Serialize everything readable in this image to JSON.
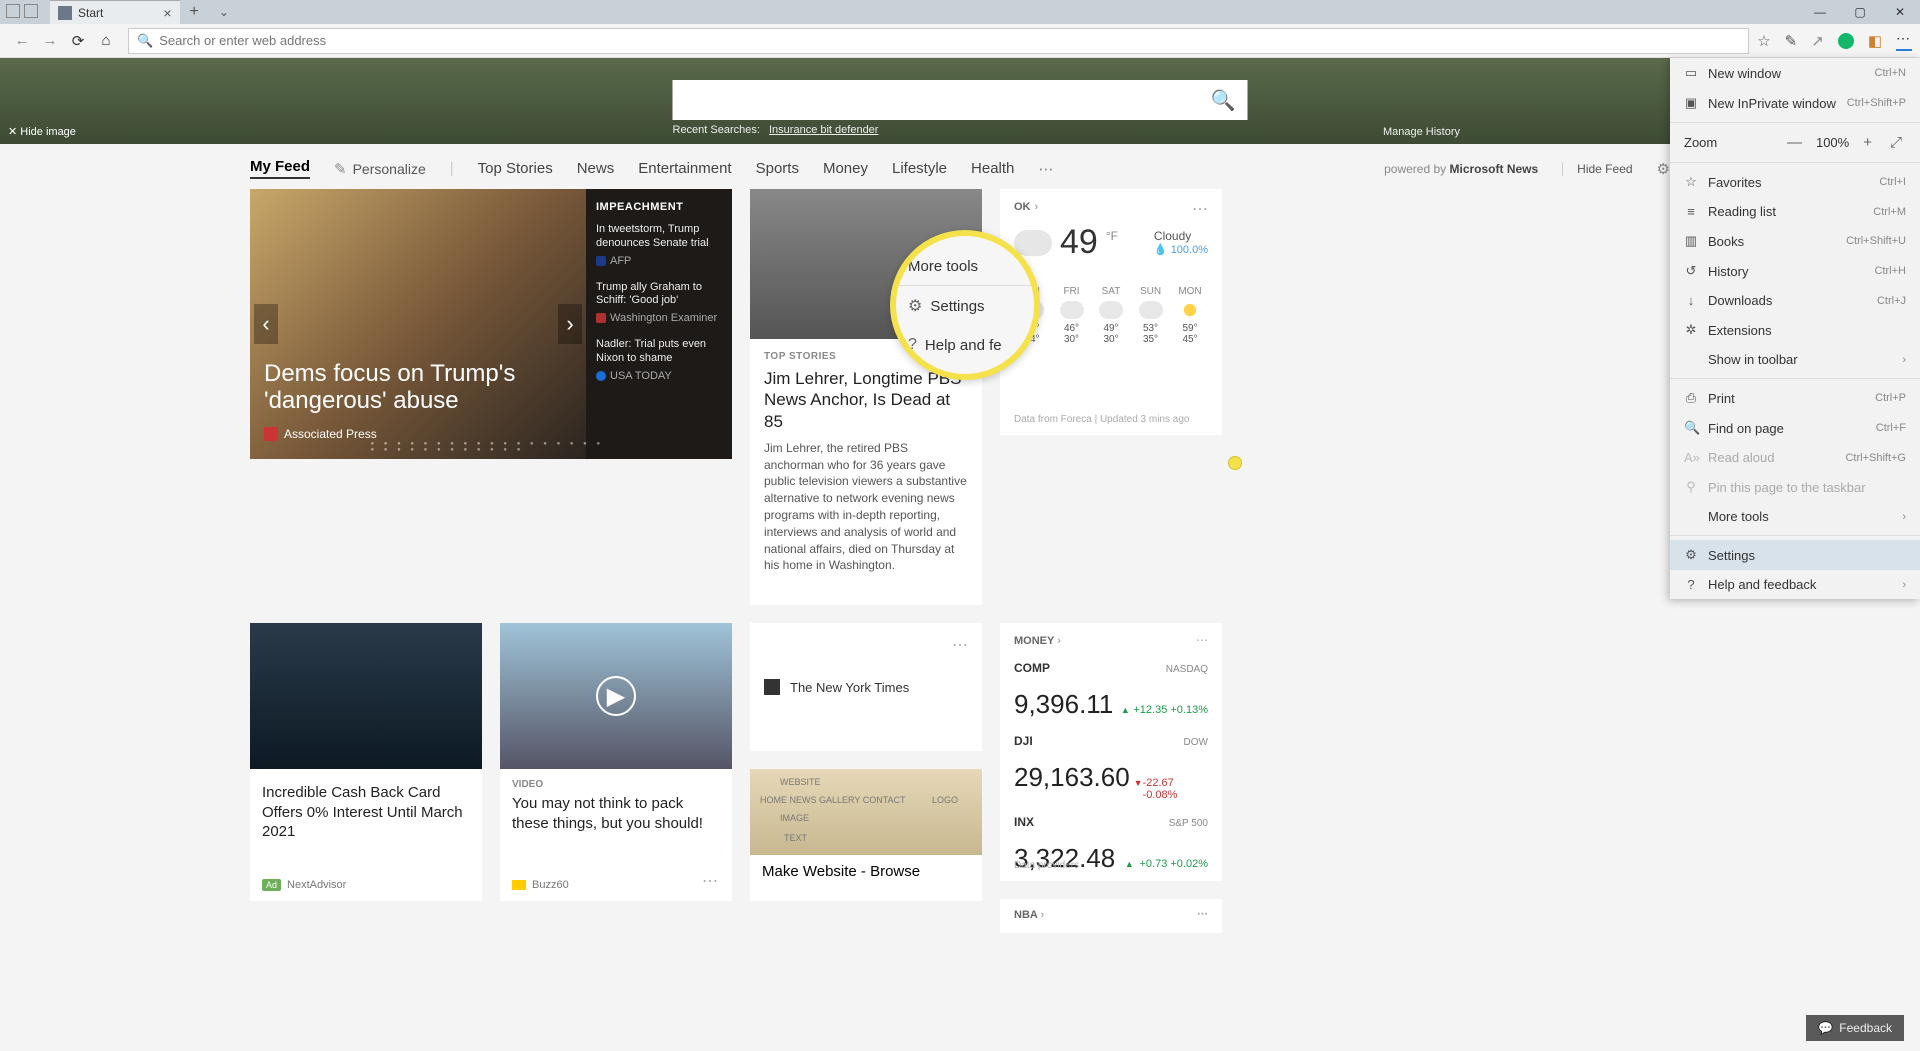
{
  "window": {
    "tab_title": "Start"
  },
  "toolbar": {
    "address_placeholder": "Search or enter web address"
  },
  "hero": {
    "hide_image": "Hide image",
    "recent_label": "Recent Searches:",
    "recent_query": "Insurance bit defender",
    "manage_history": "Manage History"
  },
  "nav": {
    "items": [
      "My Feed",
      "Personalize",
      "Top Stories",
      "News",
      "Entertainment",
      "Sports",
      "Money",
      "Lifestyle",
      "Health"
    ],
    "powered_prefix": "powered by ",
    "powered_brand": "Microsoft News",
    "hide_feed": "Hide Feed"
  },
  "big_card": {
    "headline": "Dems focus on Trump's 'dangerous' abuse",
    "source": "Associated Press",
    "side_category": "IMPEACHMENT",
    "side_items": [
      {
        "title": "In tweetstorm, Trump denounces Senate trial",
        "source": "AFP",
        "color": "#1b3a8a"
      },
      {
        "title": "Trump ally Graham to Schiff: 'Good job'",
        "source": "Washington Examiner",
        "color": "#b03030"
      },
      {
        "title": "Nadler: Trial puts even Nixon to shame",
        "source": "USA TODAY",
        "color": "#1a6ed8"
      }
    ]
  },
  "top_card": {
    "category": "TOP STORIES",
    "title": "Jim Lehrer, Longtime PBS News Anchor, Is Dead at 85",
    "summary": "Jim Lehrer, the retired PBS anchorman who for 36 years gave public television viewers a substantive alternative to network evening news programs with in-depth reporting, interviews and analysis of world and national affairs, died on Thursday at his home in Washington."
  },
  "weather": {
    "location": "OK",
    "temp": "49",
    "unit": "°F",
    "condition": "Cloudy",
    "humidity": "100.0%",
    "days": [
      {
        "label": "FRI",
        "hi": "46°",
        "lo": "34°"
      },
      {
        "label": "FRI",
        "hi": "46°",
        "lo": "30°"
      },
      {
        "label": "SAT",
        "hi": "49°",
        "lo": "30°"
      },
      {
        "label": "SUN",
        "hi": "53°",
        "lo": "35°"
      },
      {
        "label": "MON",
        "hi": "59°",
        "lo": "45°",
        "sunny": true
      }
    ],
    "footer": "Data from Foreca | Updated 3 mins ago"
  },
  "card_cash": {
    "title": "Incredible Cash Back Card Offers 0% Interest Until March 2021",
    "ad_label": "Ad",
    "source": "NextAdvisor"
  },
  "card_video": {
    "category": "VIDEO",
    "title": "You may not think to pack these things, but you should!",
    "source": "Buzz60"
  },
  "card_nyt": {
    "source": "The New York Times"
  },
  "card_web": {
    "title": "Make Website - Browse"
  },
  "money": {
    "header": "MONEY",
    "rows": [
      {
        "sym": "COMP",
        "exch": "NASDAQ",
        "val": "9,396.11",
        "dir": "up",
        "delta": "+12.35  +0.13%"
      },
      {
        "sym": "DJI",
        "exch": "DOW",
        "val": "29,163.60",
        "dir": "dn",
        "delta": "-22.67  -0.08%"
      },
      {
        "sym": "INX",
        "exch": "S&P 500",
        "val": "3,322.48",
        "dir": "up",
        "delta": "+0.73  +0.02%"
      }
    ],
    "footer": "Data providers"
  },
  "nba": {
    "label": "NBA"
  },
  "menu": {
    "new_window": "New window",
    "sc_new_window": "Ctrl+N",
    "new_inprivate": "New InPrivate window",
    "sc_new_inprivate": "Ctrl+Shift+P",
    "zoom_label": "Zoom",
    "zoom_value": "100%",
    "favorites": "Favorites",
    "sc_favorites": "Ctrl+I",
    "reading_list": "Reading list",
    "sc_reading": "Ctrl+M",
    "books": "Books",
    "sc_books": "Ctrl+Shift+U",
    "history": "History",
    "sc_history": "Ctrl+H",
    "downloads": "Downloads",
    "sc_downloads": "Ctrl+J",
    "extensions": "Extensions",
    "show_toolbar": "Show in toolbar",
    "print": "Print",
    "sc_print": "Ctrl+P",
    "find": "Find on page",
    "sc_find": "Ctrl+F",
    "read_aloud": "Read aloud",
    "sc_read": "Ctrl+Shift+G",
    "pin": "Pin this page to the taskbar",
    "more_tools": "More tools",
    "settings": "Settings",
    "help": "Help and feedback"
  },
  "callout": {
    "more_tools": "More tools",
    "settings": "Settings",
    "help": "Help and fe"
  },
  "feedback": {
    "label": "Feedback"
  }
}
